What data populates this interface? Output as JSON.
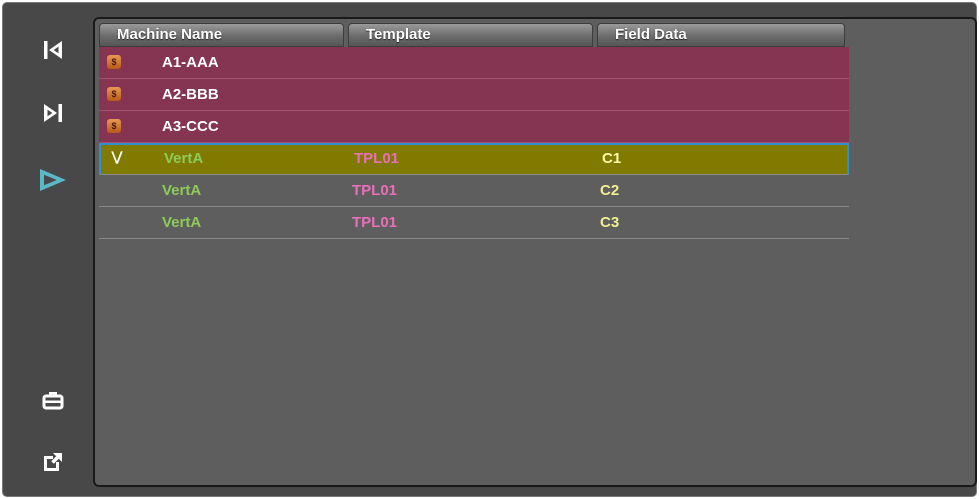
{
  "toolbar": {
    "items": [
      {
        "name": "first-record-icon"
      },
      {
        "name": "last-record-icon"
      },
      {
        "name": "play-icon"
      },
      {
        "name": "toolbox-icon"
      },
      {
        "name": "export-icon"
      }
    ]
  },
  "table": {
    "columns": [
      "Machine Name",
      "Template",
      "Field Data"
    ],
    "groups": [
      {
        "label": "A1-AAA"
      },
      {
        "label": "A2-BBB"
      },
      {
        "label": "A3-CCC"
      }
    ],
    "rows": [
      {
        "machine": "VertA",
        "template": "TPL01",
        "field": "C1"
      },
      {
        "machine": "VertA",
        "template": "TPL01",
        "field": "C2"
      },
      {
        "machine": "VertA",
        "template": "TPL01",
        "field": "C3"
      }
    ]
  },
  "colors": {
    "group_row": "#853452",
    "selected_row": "#807a00",
    "selection_border": "#2f8fd0",
    "machine_text": "#8ccc5a",
    "template_text": "#e870b8",
    "field_text": "#f0f090",
    "accent_play": "#5ab8c8"
  }
}
